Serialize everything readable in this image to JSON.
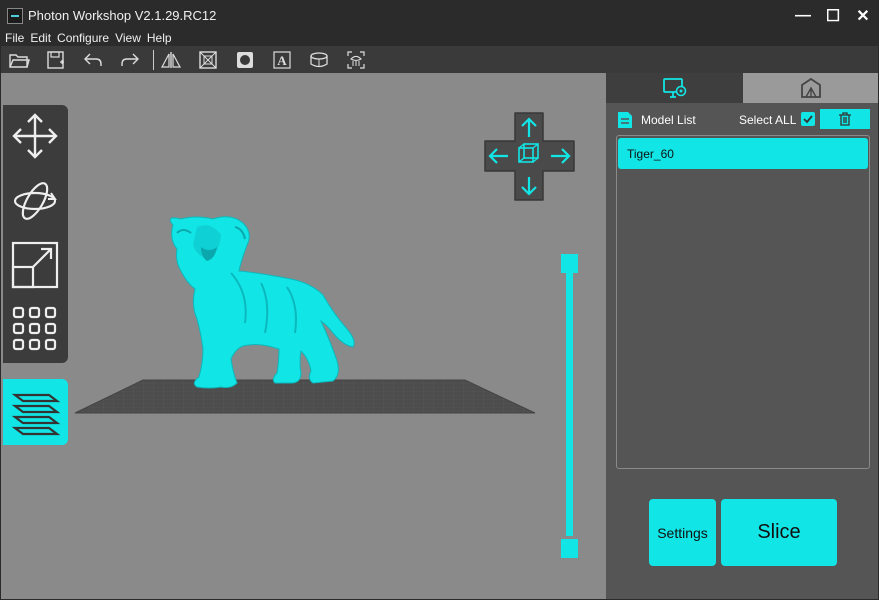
{
  "app": {
    "title": "Photon Workshop V2.1.29.RC12"
  },
  "window_controls": {
    "minimize": "—",
    "maximize": "☐",
    "close": "✕"
  },
  "menu": {
    "items": [
      "File",
      "Edit",
      "Configure",
      "View",
      "Help"
    ]
  },
  "toolbar": {
    "icons": [
      "open-folder-icon",
      "save-icon",
      "undo-icon",
      "redo-icon",
      "mirror-icon",
      "hollow-icon",
      "punch-hole-icon",
      "text-icon",
      "slice-cut-icon",
      "auto-support-icon"
    ]
  },
  "left_tools": [
    "move-icon",
    "rotate-icon",
    "scale-icon",
    "arrange-icon",
    "layers-icon"
  ],
  "right_panel": {
    "tabs": [
      "model-settings-tab",
      "supports-tab"
    ],
    "model_list_label": "Model List",
    "select_all_label": "Select ALL",
    "select_all_checked": true,
    "models": [
      {
        "name": "Tiger_60",
        "selected": true
      }
    ],
    "settings_button": "Settings",
    "slice_button": "Slice"
  },
  "layer_slider": {
    "min_fraction": 0.0,
    "max_fraction": 1.0
  },
  "colors": {
    "accent": "#12e5e5",
    "viewport_bg": "#8a8a8a",
    "panel_bg": "#555555",
    "titlebar_bg": "#2b2b2b"
  }
}
